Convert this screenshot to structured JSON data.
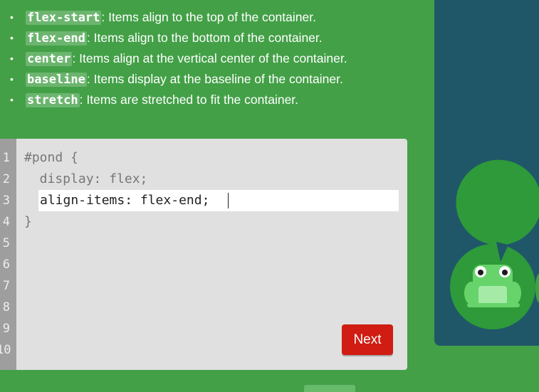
{
  "instructions": {
    "items": [
      {
        "code": "flex-start",
        "text": ": Items align to the top of the container."
      },
      {
        "code": "flex-end",
        "text": ": Items align to the bottom of the container."
      },
      {
        "code": "center",
        "text": ": Items align at the vertical center of the container."
      },
      {
        "code": "baseline",
        "text": ": Items display at the baseline of the container."
      },
      {
        "code": "stretch",
        "text": ": Items are stretched to fit the container."
      }
    ]
  },
  "editor": {
    "line_numbers": [
      "1",
      "2",
      "3",
      "4",
      "5",
      "6",
      "7",
      "8",
      "9",
      "10"
    ],
    "line1": "#pond {",
    "line2": "  display: flex;",
    "input_value": "align-items: flex-end;",
    "line4": "}",
    "next_label": "Next"
  },
  "pond": {
    "lilypad_color": "#2e9a3a",
    "frog_color": "#66d46a",
    "icon": "frog-icon"
  },
  "colors": {
    "background": "#43a047",
    "pond": "#1f5768",
    "next_button": "#d01c12"
  }
}
